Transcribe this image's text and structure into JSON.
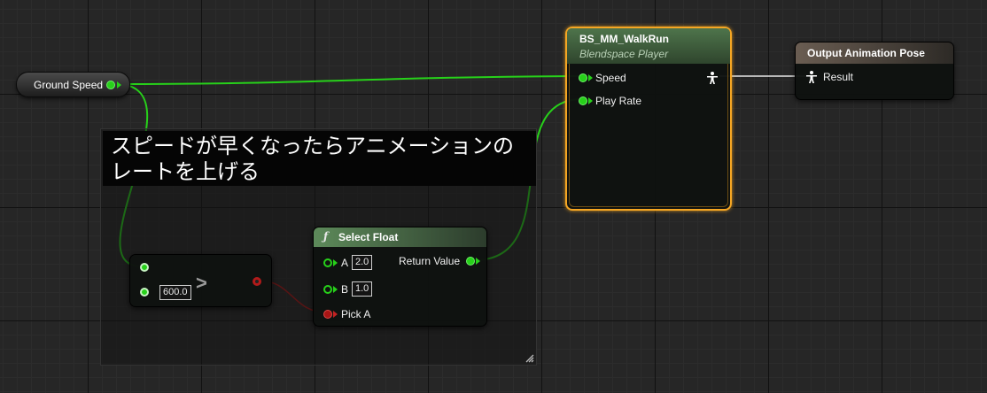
{
  "comment": {
    "line1": "スピードが早くなったらアニメーションの",
    "line2": "レートを上げる"
  },
  "ground_speed_node": {
    "label": "Ground Speed"
  },
  "compare_node": {
    "operator": ">",
    "b_value": "600.0"
  },
  "select_float_node": {
    "icon": "ƒ",
    "title": "Select Float",
    "pin_a_label": "A",
    "pin_a_value": "2.0",
    "pin_b_label": "B",
    "pin_b_value": "1.0",
    "pick_a_label": "Pick A",
    "return_label": "Return Value"
  },
  "blendspace_node": {
    "title": "BS_MM_WalkRun",
    "subtitle": "Blendspace Player",
    "speed_label": "Speed",
    "play_rate_label": "Play Rate"
  },
  "output_node": {
    "title": "Output Animation Pose",
    "result_label": "Result"
  },
  "colors": {
    "float_pin": "#27d11a",
    "bool_pin": "#a81515",
    "selected_border": "#f5a623",
    "grid_background": "#262626"
  }
}
